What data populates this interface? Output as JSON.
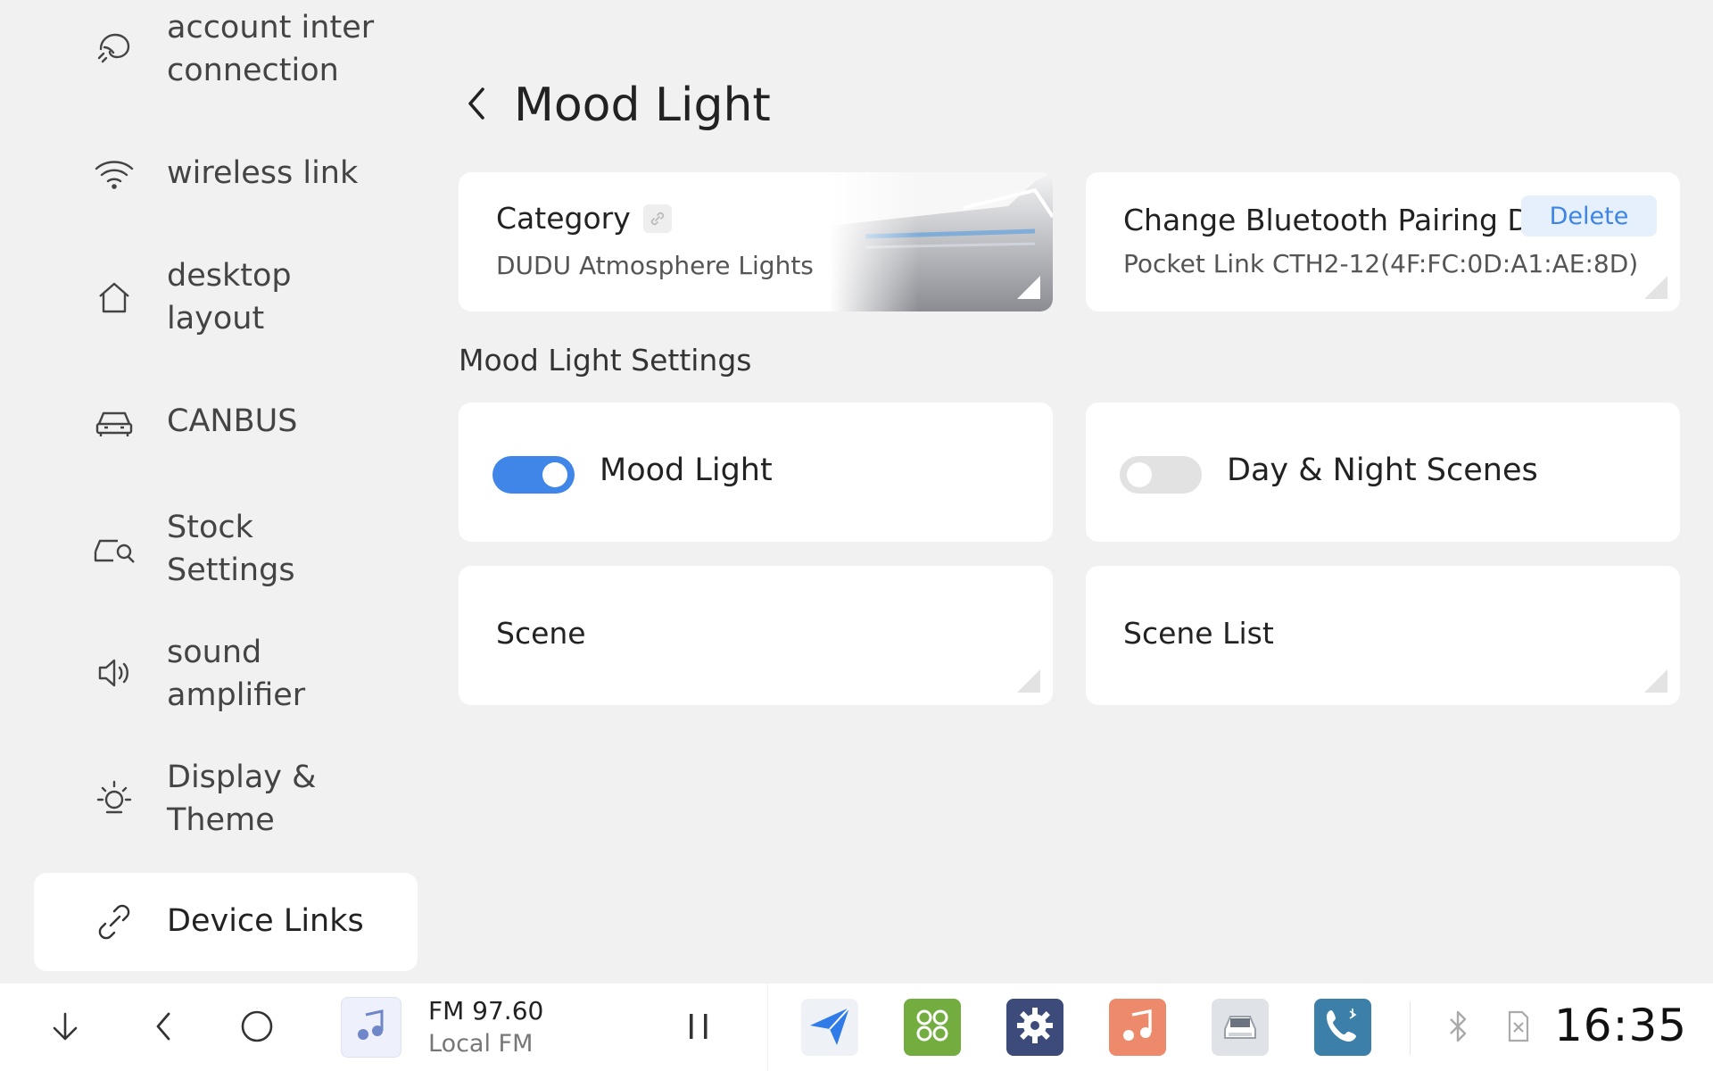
{
  "sidebar": {
    "items": [
      {
        "label_1": "account inter",
        "label_2": "connection",
        "icon": "account-link-icon"
      },
      {
        "label": "wireless link",
        "icon": "wifi-icon"
      },
      {
        "label_1": "desktop",
        "label_2": "layout",
        "icon": "home-icon"
      },
      {
        "label": "CANBUS",
        "icon": "car-icon"
      },
      {
        "label_1": "Stock",
        "label_2": "Settings",
        "icon": "car-wrench-icon"
      },
      {
        "label_1": "sound",
        "label_2": "amplifier",
        "icon": "speaker-icon"
      },
      {
        "label_1": "Display &",
        "label_2": "Theme",
        "icon": "sun-icon"
      },
      {
        "label": "Device Links",
        "icon": "link-icon",
        "active": true
      }
    ]
  },
  "header": {
    "title": "Mood Light"
  },
  "cards": {
    "category": {
      "title": "Category",
      "subtitle": "DUDU Atmosphere Lights"
    },
    "bluetooth": {
      "title": "Change Bluetooth Pairing De",
      "subtitle": "Pocket Link CTH2-12(4F:FC:0D:A1:AE:8D)",
      "delete_label": "Delete"
    },
    "section_label": "Mood Light Settings",
    "mood_light": {
      "label": "Mood Light",
      "on": true
    },
    "day_night": {
      "label": "Day & Night Scenes",
      "on": false
    },
    "scene": {
      "title": "Scene"
    },
    "scene_list": {
      "title": "Scene List"
    }
  },
  "taskbar": {
    "radio_name": "FM 97.60",
    "radio_sub": "Local FM",
    "clock": "16:35",
    "apps": [
      "navigation-app",
      "apps-grid-app",
      "settings-app",
      "music-app",
      "car-app",
      "phone-app"
    ]
  },
  "colors": {
    "accent": "#3f86e8",
    "background": "#f1f1f1",
    "card": "#ffffff"
  }
}
